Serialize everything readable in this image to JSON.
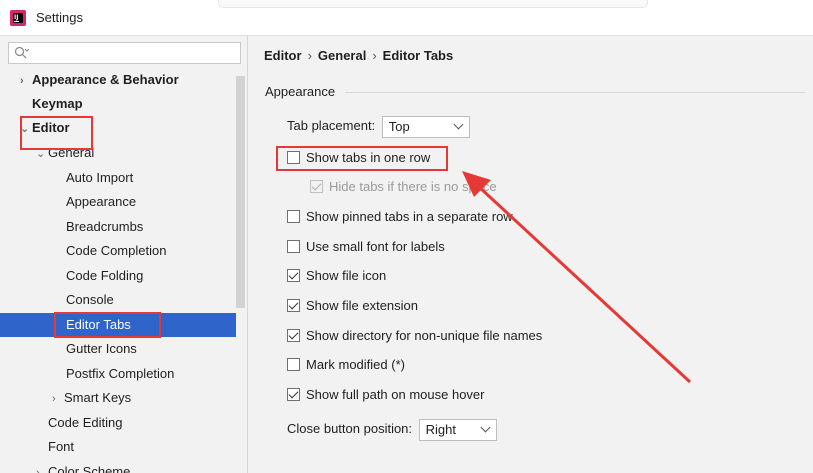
{
  "window": {
    "title": "Settings",
    "logo": "intellij-logo-icon"
  },
  "search": {
    "icon": "search-icon",
    "value": ""
  },
  "tree": [
    {
      "label": "Appearance & Behavior",
      "bold": true,
      "arrow": "chevron-right-icon"
    },
    {
      "label": "Keymap",
      "bold": true
    },
    {
      "label": "Editor",
      "bold": true,
      "arrow": "chevron-down-icon"
    },
    {
      "label": "General",
      "arrow": "chevron-down-icon"
    },
    {
      "label": "Auto Import"
    },
    {
      "label": "Appearance"
    },
    {
      "label": "Breadcrumbs"
    },
    {
      "label": "Code Completion"
    },
    {
      "label": "Code Folding"
    },
    {
      "label": "Console"
    },
    {
      "label": "Editor Tabs",
      "selected": true
    },
    {
      "label": "Gutter Icons"
    },
    {
      "label": "Postfix Completion"
    },
    {
      "label": "Smart Keys",
      "arrow": "chevron-right-icon"
    },
    {
      "label": "Code Editing"
    },
    {
      "label": "Font"
    },
    {
      "label": "Color Scheme",
      "arrow": "chevron-right-icon"
    }
  ],
  "breadcrumb": [
    "Editor",
    "General",
    "Editor Tabs"
  ],
  "breadcrumb_sep": "›",
  "section_title": "Appearance",
  "tab_placement": {
    "label": "Tab placement:",
    "value": "Top"
  },
  "options": [
    {
      "label": "Show tabs in one row",
      "checked": false
    },
    {
      "label": "Hide tabs if there is no space",
      "checked": true,
      "disabled": true
    },
    {
      "label": "Show pinned tabs in a separate row",
      "checked": false
    },
    {
      "label": "Use small font for labels",
      "checked": false
    },
    {
      "label": "Show file icon",
      "checked": true
    },
    {
      "label": "Show file extension",
      "checked": true
    },
    {
      "label": "Show directory for non-unique file names",
      "checked": true
    },
    {
      "label": "Mark modified (*)",
      "checked": false
    },
    {
      "label": "Show full path on mouse hover",
      "checked": true
    }
  ],
  "close_button": {
    "label": "Close button position:",
    "value": "Right"
  },
  "colors": {
    "selection": "#2f65ca",
    "annotation": "#e53935"
  }
}
